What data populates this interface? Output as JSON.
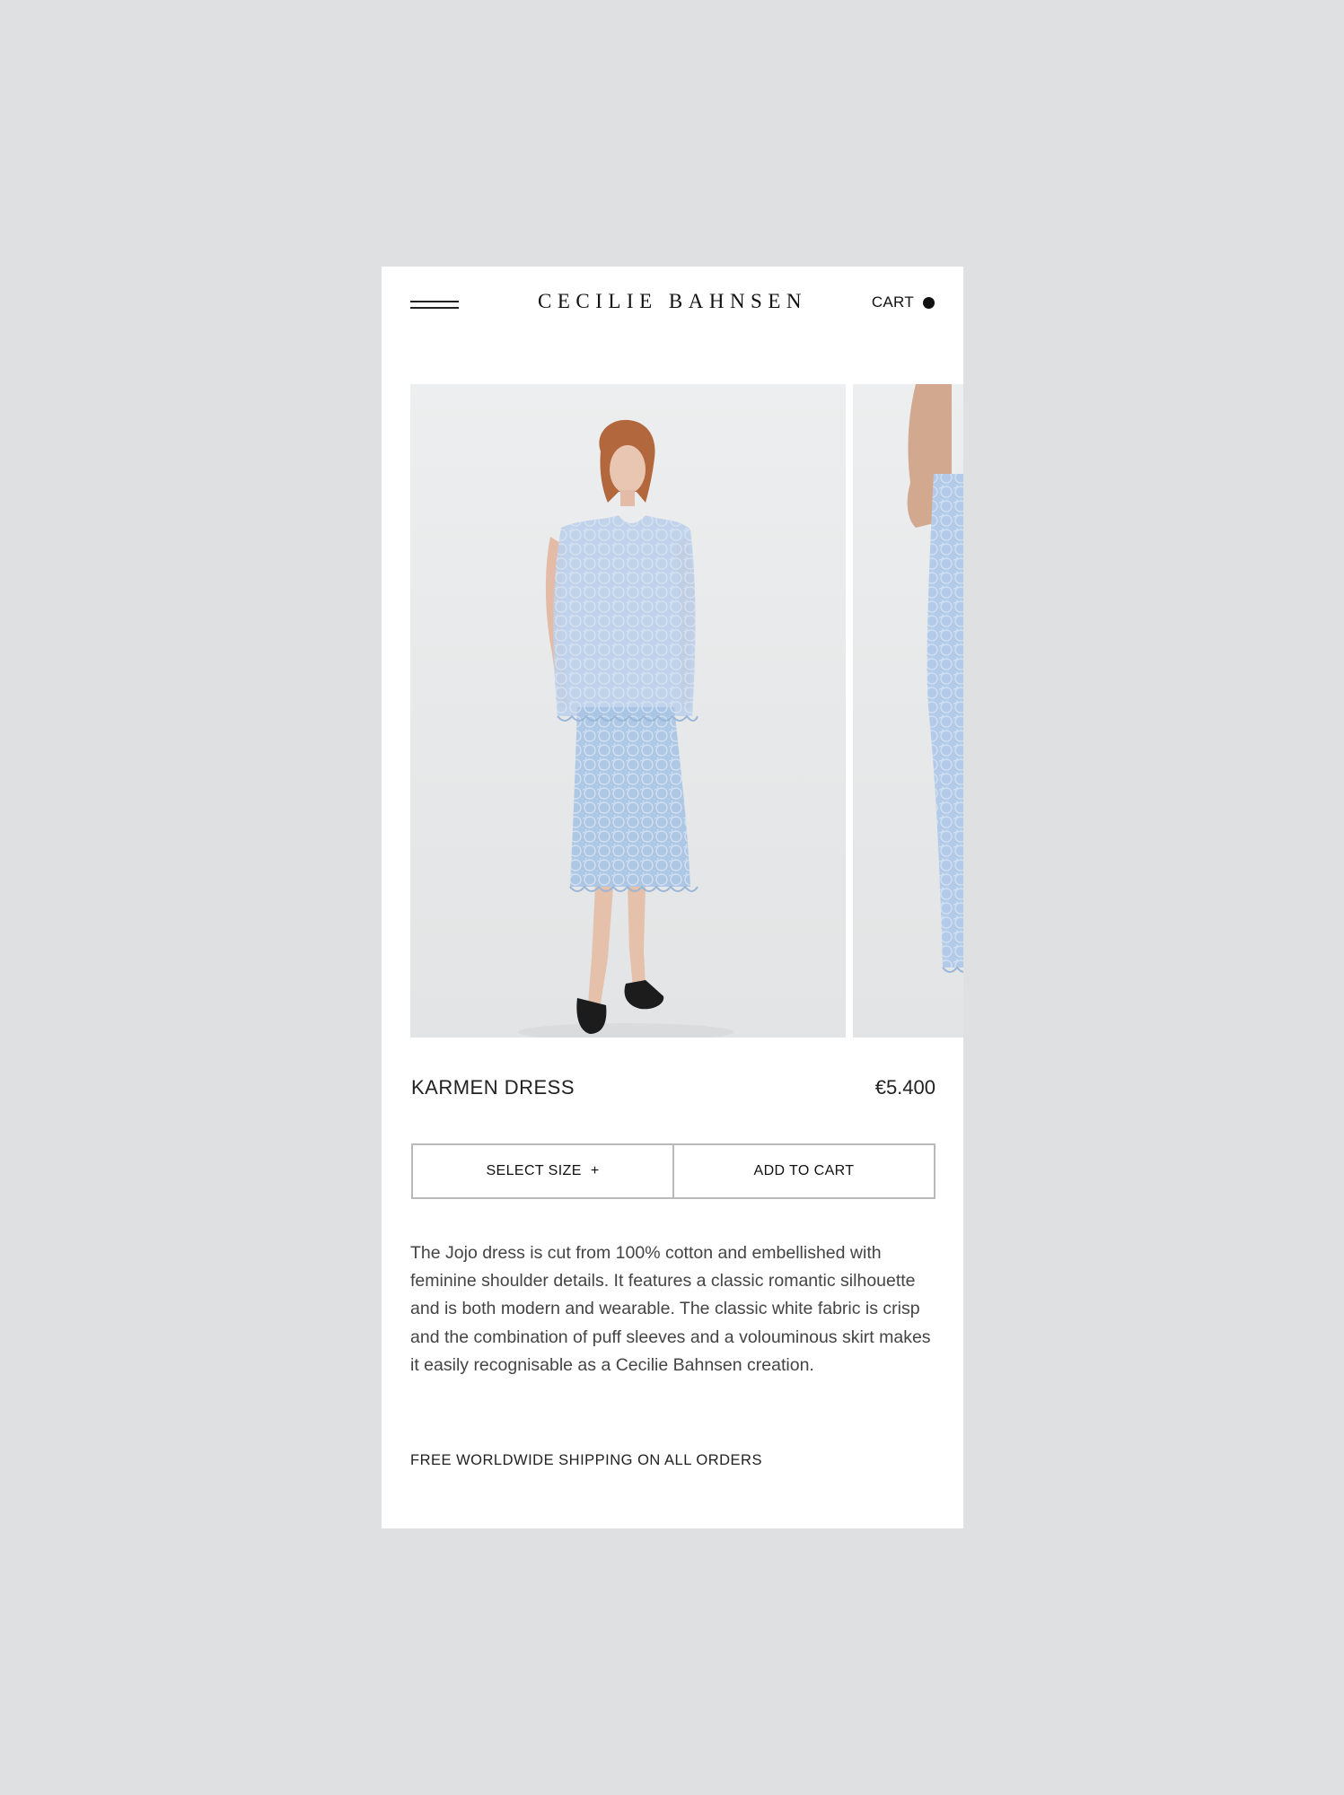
{
  "header": {
    "logo": "CECILIE BAHNSEN",
    "cart_label": "CART",
    "menu_icon": "hamburger-icon",
    "cart_icon": "cart-dot-icon"
  },
  "gallery": {
    "images": [
      {
        "label": "Model wearing light blue lace top and skirt, front view"
      },
      {
        "label": "Model wearing light blue lace top and skirt, close side view"
      }
    ]
  },
  "product": {
    "name": "KARMEN DRESS",
    "price": "€5.400",
    "select_size_label": "SELECT SIZE",
    "select_size_icon": "+",
    "add_to_cart_label": "ADD TO CART",
    "description": "The Jojo dress is cut from 100% cotton and embellished with feminine shoulder details. It features a classic romantic silhouette and is both modern and wearable. The classic white fabric is crisp and the combination of puff sleeves and a volouminous skirt makes it easily recognisable as a Cecilie Bahnsen creation.",
    "shipping_note": "FREE WORLDWIDE SHIPPING ON ALL ORDERS"
  },
  "colors": {
    "background": "#dfe0e1",
    "surface": "#ffffff",
    "text": "#222222",
    "border": "#b9b9b9",
    "dress_blue": "#a9c4e4"
  }
}
